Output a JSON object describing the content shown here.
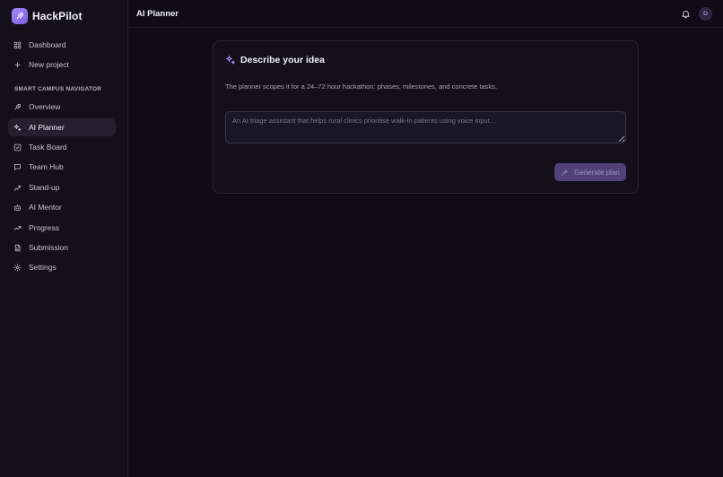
{
  "app": {
    "name": "HackPilot"
  },
  "nav_top": [
    {
      "label": "Dashboard",
      "icon": "grid-icon"
    },
    {
      "label": "New project",
      "icon": "plus-icon"
    }
  ],
  "section": {
    "label": "SMART CAMPUS NAVIGATOR"
  },
  "nav_project": [
    {
      "label": "Overview",
      "icon": "rocket-icon"
    },
    {
      "label": "AI Planner",
      "icon": "sparkles-icon",
      "active": true
    },
    {
      "label": "Task Board",
      "icon": "check-square-icon"
    },
    {
      "label": "Team Hub",
      "icon": "chat-icon"
    },
    {
      "label": "Stand-up",
      "icon": "stand-up-icon"
    },
    {
      "label": "AI Mentor",
      "icon": "bot-icon"
    },
    {
      "label": "Progress",
      "icon": "trending-up-icon"
    },
    {
      "label": "Submission",
      "icon": "file-icon"
    },
    {
      "label": "Settings",
      "icon": "gear-icon"
    }
  ],
  "header": {
    "title": "AI Planner",
    "avatar_initial": "D"
  },
  "card": {
    "title": "Describe your idea",
    "description": "The planner scopes it for a 24–72 hour hackathon: phases, milestones, and concrete tasks.",
    "input_value": "",
    "input_placeholder": "An AI triage assistant that helps rural clinics prioritise walk-in patients using voice input...",
    "button_label": "Generate plan"
  },
  "colors": {
    "background": "#0f0c17",
    "sidebar": "#13101b",
    "accent": "#a78bfa",
    "button": "#5b4a8a",
    "active_item": "#24202e"
  }
}
